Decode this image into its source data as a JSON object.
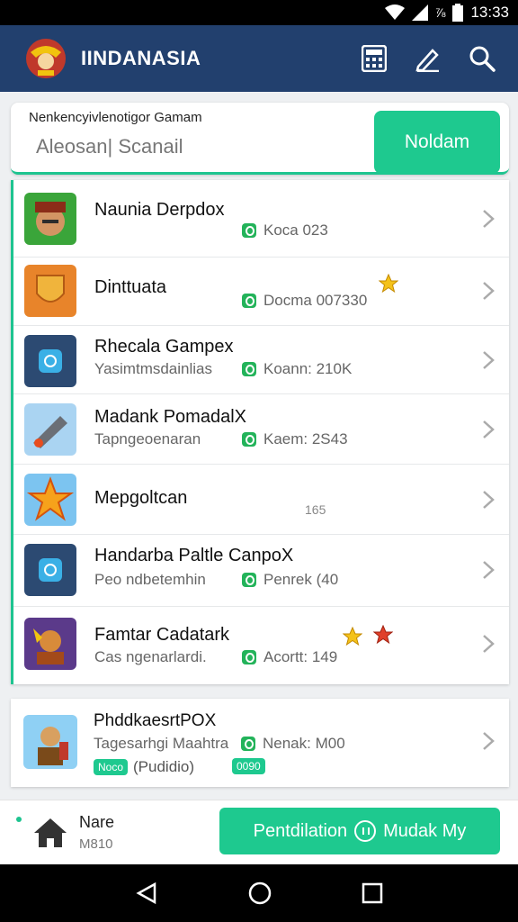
{
  "status_bar": {
    "time": "13:33",
    "battery_label": "⅞",
    "icons": [
      "wifi-icon",
      "signal-icon",
      "battery-icon"
    ]
  },
  "app_bar": {
    "title": "IINDANASIA",
    "actions": [
      "calculator-icon",
      "edit-icon",
      "search-icon"
    ]
  },
  "search": {
    "label": "Nenkencyivlenotigor Gamam",
    "value": "Aleosan| Scanail",
    "button": "Noldam"
  },
  "list": [
    {
      "name": "Naunia Derpdox",
      "sub": "",
      "meta": "Koca 023"
    },
    {
      "name": "Dinttuata",
      "sub": "",
      "meta": "Docma 007330"
    },
    {
      "name": "Rhecala Gampex",
      "sub": "Yasimtmsdainlias",
      "meta": "Koann: 210K"
    },
    {
      "name": "Madank PomadalX",
      "sub": "Tapngeoenaran",
      "meta": "Kaem: 2S43"
    },
    {
      "name": "Mepgoltcan",
      "sub": "",
      "meta": "165"
    },
    {
      "name": "Handarba Paltle CanpoX",
      "sub": "Peo ndbetemhin",
      "meta": "Penrek (40"
    },
    {
      "name": "Famtar Cadatark",
      "sub": "Cas ngenarlardi.",
      "meta": "Acortt: 149"
    }
  ],
  "promo": {
    "name": "PhddkaesrtPOX",
    "sub": "Tagesarhgi Maahtra",
    "meta": "Nenak: M00",
    "tag_pill": "Noco",
    "tag_text": "(Pudidio)",
    "tag_pill2": "0090"
  },
  "bottom_bar": {
    "name": "Nare",
    "sub": "M810",
    "cta": "Pentdilation",
    "cta2": "Mudak My"
  },
  "colors": {
    "primary": "#22406e",
    "accent": "#1ec98f",
    "badge": "#23b35a"
  }
}
